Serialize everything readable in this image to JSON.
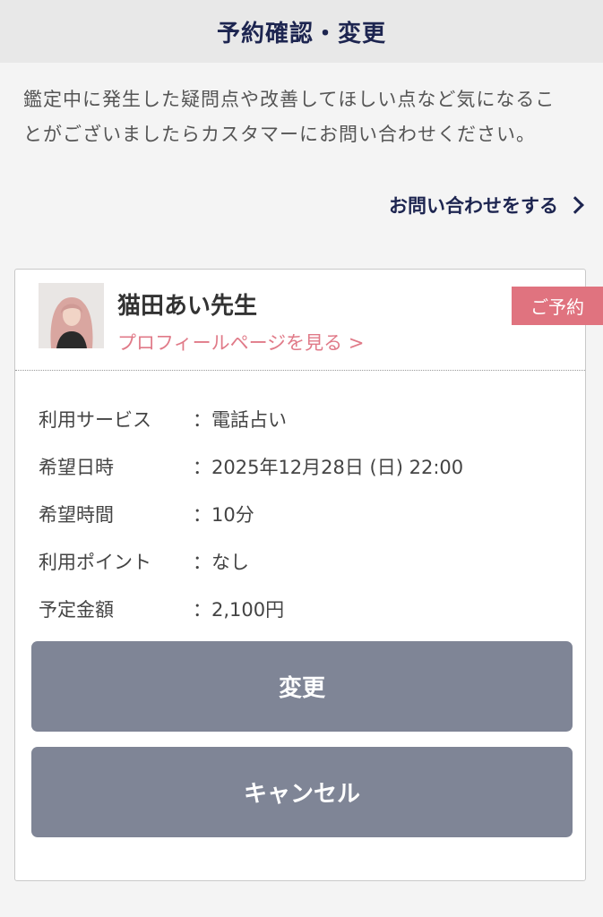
{
  "header": {
    "title": "予約確認・変更"
  },
  "notice": {
    "text": "鑑定中に発生した疑問点や改善してほしい点など気になることがございましたらカスタマーにお問い合わせください。"
  },
  "contact": {
    "label": "お問い合わせをする",
    "icon": "chevron-right-icon"
  },
  "reservation": {
    "badge": "ご予約",
    "teacher_name": "猫田あい先生",
    "profile_link": "プロフィールページを見る >",
    "details": [
      {
        "label": "利用サービス",
        "value": "：電話占い"
      },
      {
        "label": "希望日時",
        "value": "：2025年12月28日 (日) 22:00"
      },
      {
        "label": "希望時間",
        "value": "：10分"
      },
      {
        "label": "利用ポイント",
        "value": "：なし"
      },
      {
        "label": "予定金額",
        "value": "：2,100円"
      }
    ],
    "change_label": "変更",
    "cancel_label": "キャンセル"
  },
  "colors": {
    "navy": "#1d2550",
    "pink": "#e0737f",
    "button_gray": "#7f8596"
  }
}
